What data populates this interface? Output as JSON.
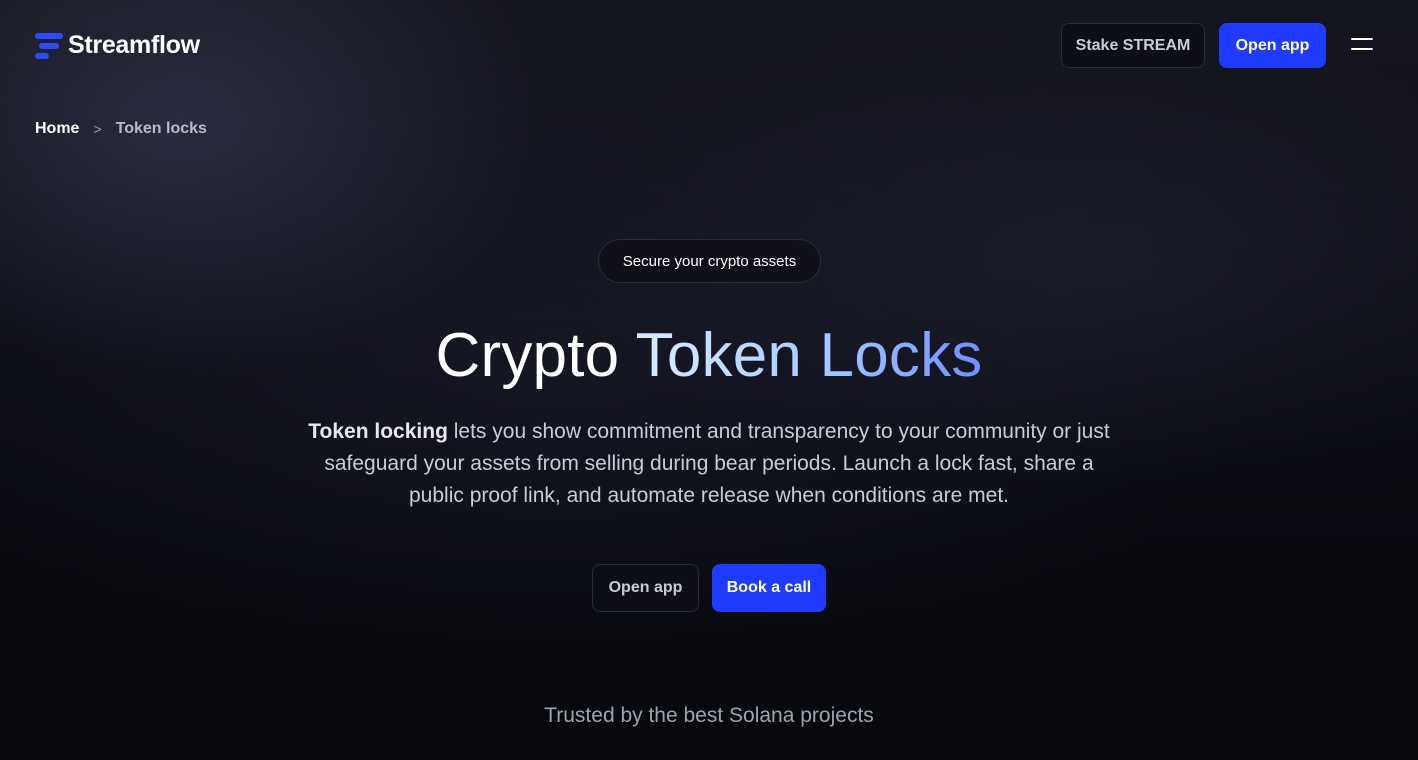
{
  "header": {
    "logo_text": "Streamflow",
    "stake_label": "Stake STREAM",
    "open_app_label": "Open app"
  },
  "breadcrumb": {
    "home": "Home",
    "separator": ">",
    "current": "Token locks"
  },
  "hero": {
    "pill": "Secure your crypto assets",
    "title_part1": "Crypto ",
    "title_part2": "Token Locks",
    "desc_bold": "Token locking",
    "desc_rest": " lets you show commitment and transparency to your community or just safeguard your assets from selling during bear periods. Launch a lock fast, share a public proof link, and automate release when conditions are met.",
    "open_app_label": "Open app",
    "book_call_label": "Book a call"
  },
  "trusted": {
    "text": "Trusted by the best Solana projects"
  },
  "colors": {
    "primary": "#1f3bff",
    "background": "#07080d"
  },
  "icons": {
    "logo": "streamflow-logo-icon",
    "menu": "hamburger-menu-icon",
    "breadcrumb_sep": "chevron-right-icon"
  }
}
